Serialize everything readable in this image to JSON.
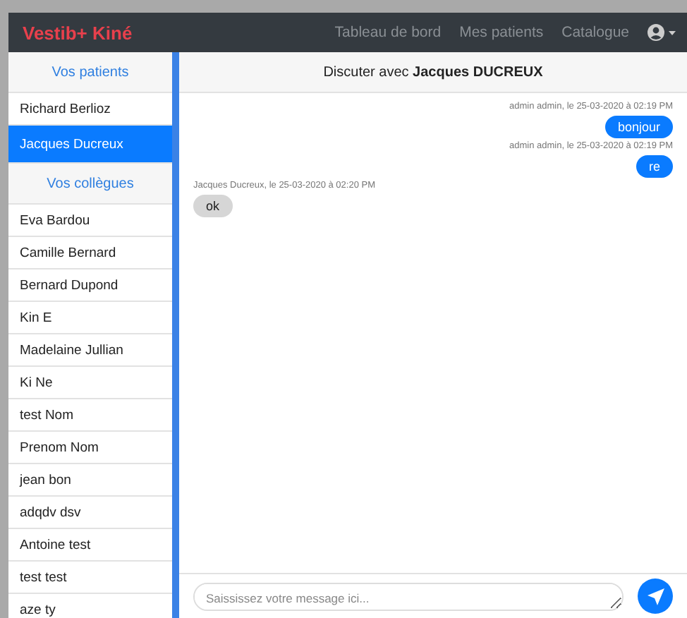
{
  "navbar": {
    "brand": "Vestib+ Kiné",
    "links": [
      "Tableau de bord",
      "Mes patients",
      "Catalogue"
    ]
  },
  "sidebar": {
    "sections": [
      {
        "title": "Vos patients",
        "items": [
          {
            "label": "Richard Berlioz",
            "selected": false
          },
          {
            "label": "Jacques Ducreux",
            "selected": true
          }
        ]
      },
      {
        "title": "Vos collègues",
        "items": [
          {
            "label": "Eva Bardou",
            "selected": false
          },
          {
            "label": "Camille Bernard",
            "selected": false
          },
          {
            "label": "Bernard Dupond",
            "selected": false
          },
          {
            "label": "Kin E",
            "selected": false
          },
          {
            "label": "Madelaine Jullian",
            "selected": false
          },
          {
            "label": "Ki Ne",
            "selected": false
          },
          {
            "label": "test Nom",
            "selected": false
          },
          {
            "label": "Prenom Nom",
            "selected": false
          },
          {
            "label": "jean bon",
            "selected": false
          },
          {
            "label": "adqdv dsv",
            "selected": false
          },
          {
            "label": "Antoine test",
            "selected": false
          },
          {
            "label": "test test",
            "selected": false
          },
          {
            "label": "aze ty",
            "selected": false
          }
        ]
      }
    ]
  },
  "chat": {
    "header": "Discuter avec **Jacques DUCREUX**",
    "messages": [
      {
        "kind": "sent",
        "meta": "admin admin, le 25-03-2020 à 02:19 PM",
        "text": "bonjour"
      },
      {
        "kind": "sent",
        "meta": "admin admin, le 25-03-2020 à 02:19 PM",
        "text": "re"
      },
      {
        "kind": "received",
        "meta": "Jacques Ducreux, le 25-03-2020 à 02:20 PM",
        "text": "ok"
      }
    ],
    "input": {
      "placeholder": "Saississez votre message ici..."
    }
  }
}
